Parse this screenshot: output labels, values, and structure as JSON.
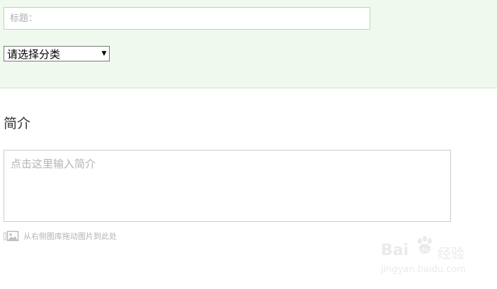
{
  "form": {
    "title_placeholder": "标题：",
    "category": {
      "selected": "请选择分类"
    }
  },
  "intro": {
    "heading": "简介",
    "placeholder": "点击这里输入简介",
    "drag_hint": "从右侧图库拖动图片到此处"
  },
  "icons": {
    "select_arrow": "dropdown-arrow-icon",
    "image_icon": "image-icon"
  },
  "watermark": {
    "brand": "Bai",
    "brand_suffix": "经验",
    "url": "jingyan.baidu.com"
  },
  "colors": {
    "panel_bg": "#f0f9ee",
    "title_border": "#b6dcaf",
    "placeholder": "#b3b3b3"
  }
}
